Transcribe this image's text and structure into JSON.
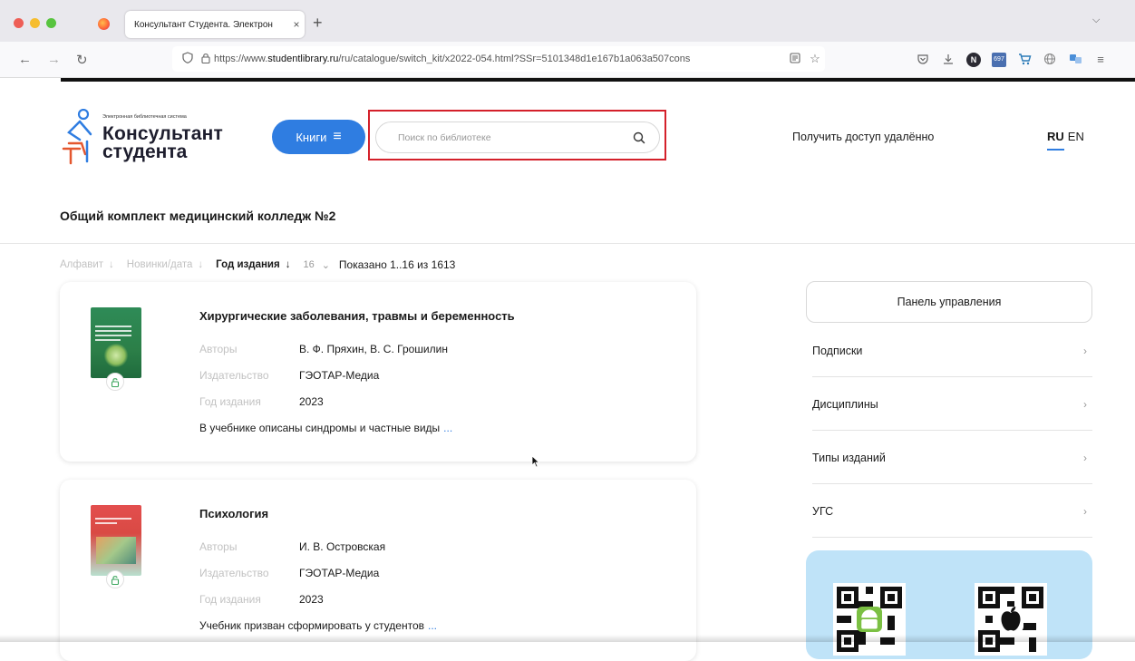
{
  "browser": {
    "tab_title": "Консультант Студента. Электрон",
    "tab_close": "×",
    "new_tab": "+",
    "tab_list": "⌵",
    "url_prefix": "https://www.",
    "url_domain": "studentlibrary.ru",
    "url_rest": "/ru/catalogue/switch_kit/x2022-054.html?SSr=5101348d1e167b1a063a507cons",
    "back": "←",
    "forward": "→",
    "reload": "↻",
    "toolbar_icons": [
      "pocket-icon",
      "download-icon",
      "extension-icon",
      "badge-extension-icon",
      "cart-extension-icon",
      "globe-icon",
      "translate-icon",
      "menu-icon"
    ],
    "badge_label": "697",
    "menu": "≡"
  },
  "header": {
    "logo_caption": "Электронная библиотечная система",
    "logo_word1": "Консультант",
    "logo_word2": "студента",
    "books_button": "Книги",
    "search_placeholder": "Поиск по библиотеке",
    "remote_access": "Получить доступ удалённо",
    "lang_ru": "RU",
    "lang_en": "EN"
  },
  "collection_title": "Общий комплект медицинский колледж №2",
  "sortbar": {
    "alphabet": "Алфавит",
    "novelty": "Новинки/дата",
    "year": "Год издания",
    "arrow": "↓",
    "per_page": "16",
    "per_page_chevron": "⌄",
    "shown": "Показано 1..16 из 1613"
  },
  "meta_labels": {
    "authors": "Авторы",
    "publisher": "Издательство",
    "year": "Год издания"
  },
  "books": [
    {
      "title": "Хирургические заболевания, травмы и беременность",
      "authors": "В. Ф. Пряхин, В. С. Грошилин",
      "publisher": "ГЭОТАР-Медиа",
      "year": "2023",
      "description": "В учебнике описаны синдромы и частные виды",
      "more": "..."
    },
    {
      "title": "Психология",
      "authors": "И. В. Островская",
      "publisher": "ГЭОТАР-Медиа",
      "year": "2023",
      "description": "Учебник призван сформировать у студентов",
      "more": "..."
    }
  ],
  "panel": {
    "control_panel": "Панель управления",
    "filters": [
      "Подписки",
      "Дисциплины",
      "Типы изданий",
      "УГС"
    ],
    "chevron": "›"
  },
  "colors": {
    "accent": "#2f7de1",
    "highlight_frame": "#d4202a",
    "qr_panel": "#bfe3f8"
  }
}
